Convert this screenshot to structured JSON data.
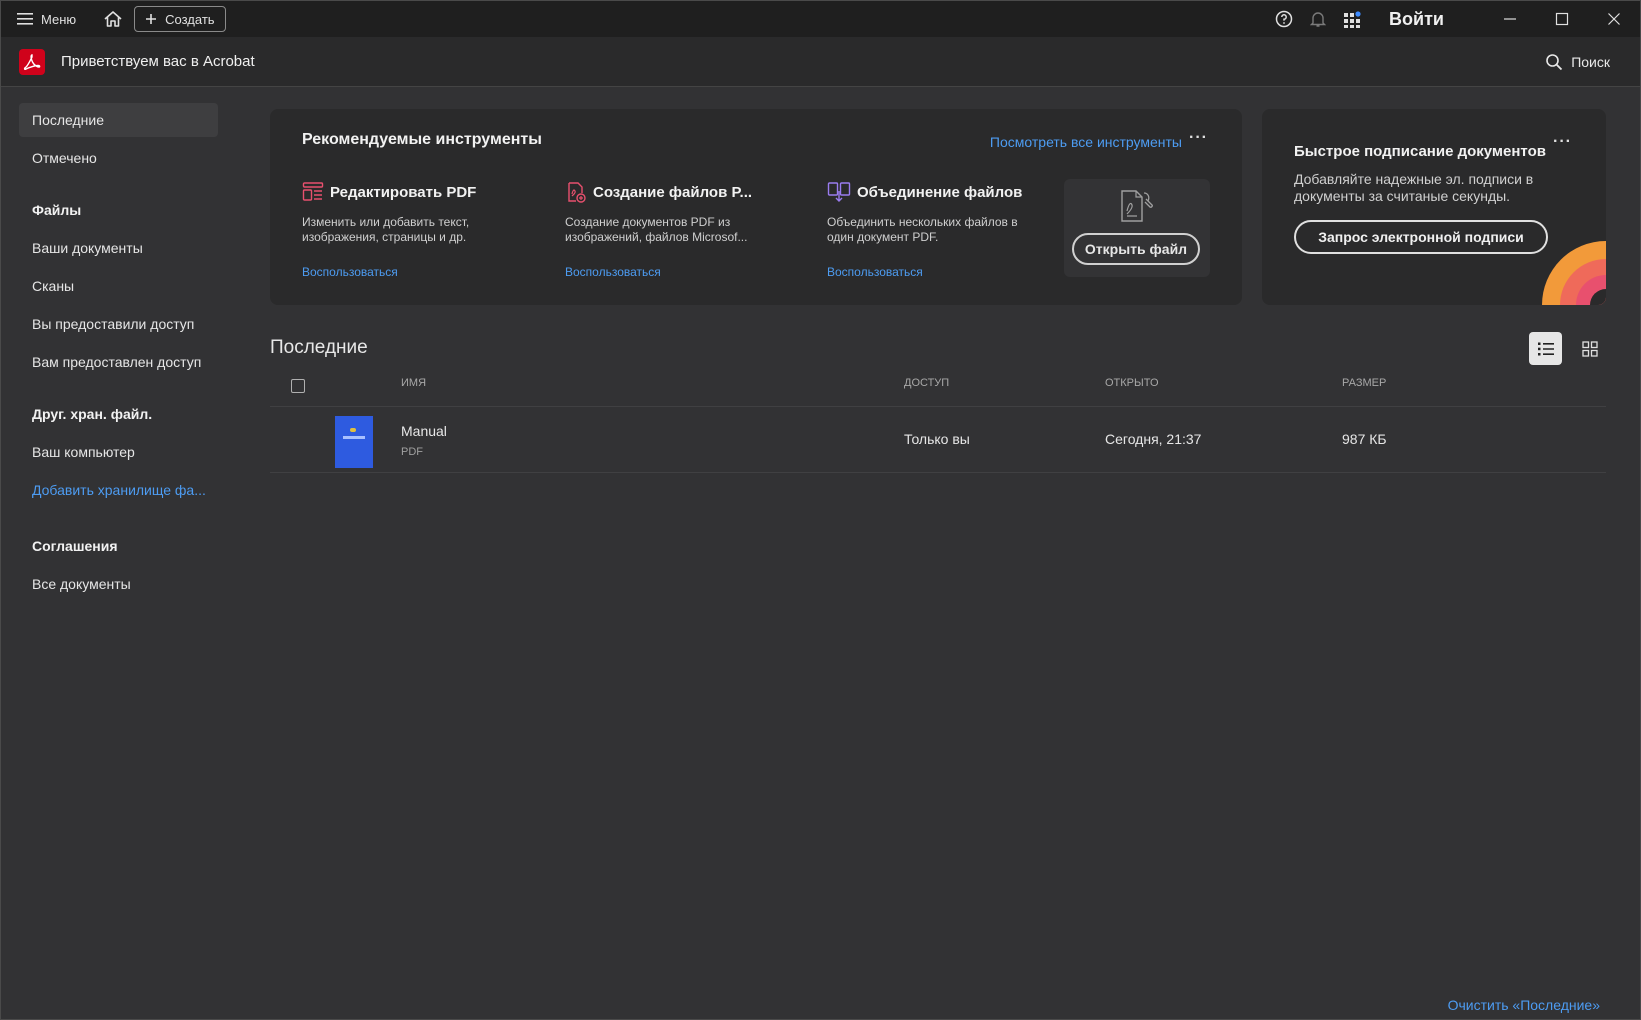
{
  "titlebar": {
    "menu_label": "Меню",
    "create_label": "Создать",
    "login_label": "Войти"
  },
  "appbar": {
    "title": "Приветствуем вас в Acrobat",
    "search_label": "Поиск"
  },
  "sidebar": {
    "items_top": [
      {
        "label": "Последние",
        "active": true
      },
      {
        "label": "Отмечено",
        "active": false
      }
    ],
    "files_heading": "Файлы",
    "files_items": [
      "Ваши документы",
      "Сканы",
      "Вы предоставили доступ",
      "Вам предоставлен доступ"
    ],
    "other_heading": "Друг. хран. файл.",
    "other_items": [
      "Ваш компьютер"
    ],
    "other_link": "Добавить хранилище фа...",
    "agreements_heading": "Соглашения",
    "agreements_items": [
      "Все документы"
    ]
  },
  "tools_card": {
    "title": "Рекомендуемые инструменты",
    "see_all": "Посмотреть все инструменты",
    "tools": [
      {
        "name": "Редактировать PDF",
        "desc": "Изменить или добавить текст, изображения, страницы и др.",
        "action": "Воспользоваться",
        "icon": "edit-pdf-icon",
        "color": "#e8506e"
      },
      {
        "name": "Создание файлов P...",
        "desc": "Создание документов PDF из изображений, файлов Microsof...",
        "action": "Воспользоваться",
        "icon": "create-pdf-icon",
        "color": "#e8506e"
      },
      {
        "name": "Объединение файлов",
        "desc": "Объединить нескольких файлов в один документ PDF.",
        "action": "Воспользоваться",
        "icon": "combine-files-icon",
        "color": "#9a7cf0"
      }
    ],
    "open_file": "Открыть файл"
  },
  "sign_card": {
    "title": "Быстрое подписание документов",
    "desc": "Добавляйте надежные эл. подписи в документы за считаные секунды.",
    "button": "Запрос электронной подписи"
  },
  "recent": {
    "title": "Последние",
    "columns": {
      "name": "Имя",
      "access": "Доступ",
      "opened": "Открыто",
      "size": "Размер"
    },
    "rows": [
      {
        "name": "Manual",
        "type": "PDF",
        "access": "Только вы",
        "opened": "Сегодня, 21:37",
        "size": "987 КБ"
      }
    ],
    "clear_label": "Очистить «Последние»"
  },
  "colors": {
    "accent": "#4d9cf2",
    "brand": "#d0021b"
  }
}
